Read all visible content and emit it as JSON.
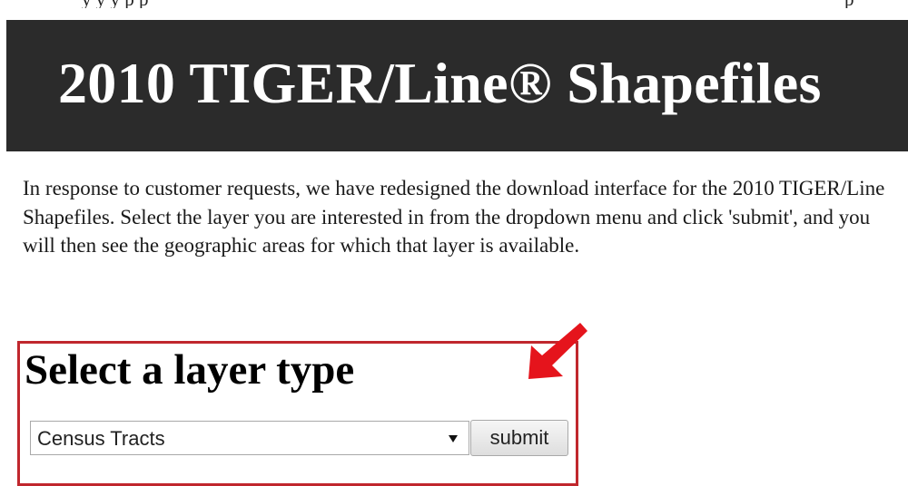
{
  "page_title": "2010 TIGER/Line® Shapefiles",
  "top_cut_text": {
    "left": "y  y  y  p  p",
    "right": "p"
  },
  "intro_text": "In response to customer requests, we have redesigned the download interface for the 2010 TIGER/Line Shapefiles. Select the layer you are interested in from the dropdown menu and click 'submit', and you will then see the geographic areas for which that layer is available.",
  "layer_selector": {
    "heading": "Select a layer type",
    "selected_option": "Census Tracts",
    "submit_label": "submit"
  },
  "colors": {
    "banner_bg": "#2b2b2b",
    "highlight_border": "#c0272d",
    "annotation_arrow": "#e5141c"
  },
  "icons": {
    "dropdown": "chevron-down-icon",
    "annotation": "red-arrow-icon"
  }
}
